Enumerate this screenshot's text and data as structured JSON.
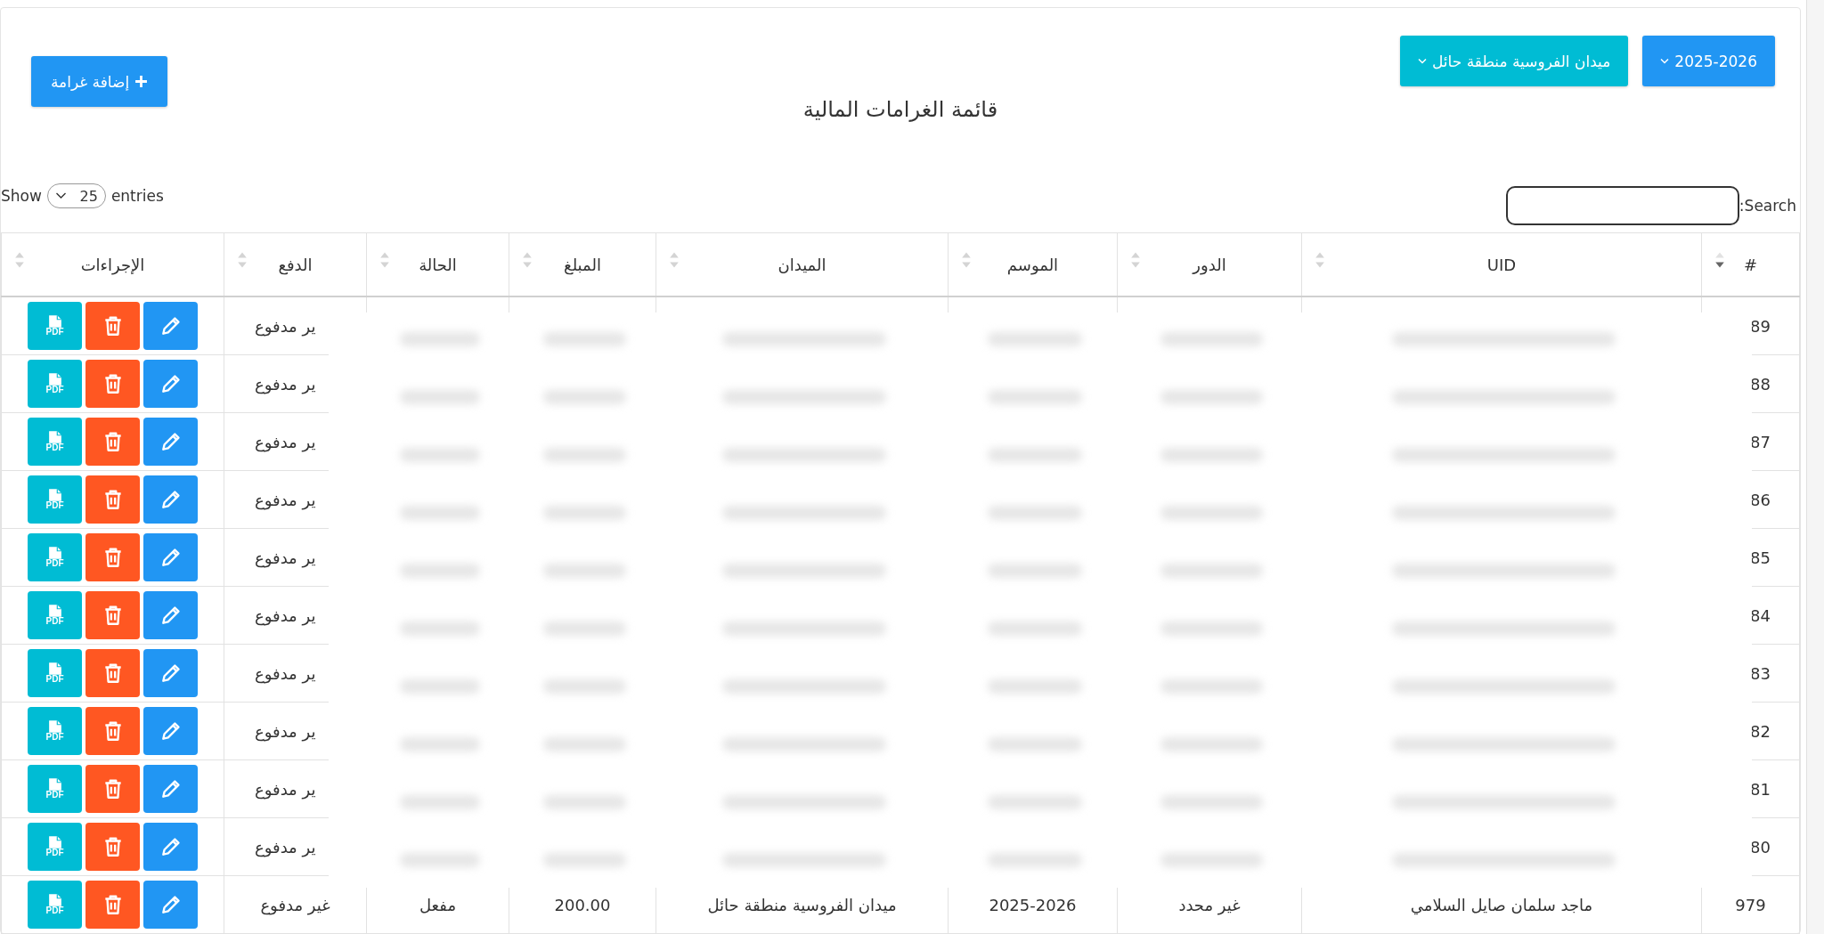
{
  "toolbar": {
    "season_button": "2025-2026",
    "arena_button": "ميدان الفروسية منطقة حائل",
    "add_button": "إضافة غرامة"
  },
  "title": "قائمة الغرامات المالية",
  "length": {
    "show": "Show",
    "value": "25",
    "entries": "entries"
  },
  "search": {
    "label": ":Search"
  },
  "table": {
    "columns": [
      {
        "label": "#",
        "sorted": true
      },
      {
        "label": "UID",
        "sorted": false
      },
      {
        "label": "الدور",
        "sorted": false
      },
      {
        "label": "الموسم",
        "sorted": false
      },
      {
        "label": "الميدان",
        "sorted": false
      },
      {
        "label": "المبلغ",
        "sorted": false
      },
      {
        "label": "الحالة",
        "sorted": false
      },
      {
        "label": "الدفع",
        "sorted": false
      },
      {
        "label": "الإجراءات",
        "sorted": false
      }
    ],
    "rows": [
      {
        "kind": "redacted",
        "number": "89",
        "payment": "ير مدفوع",
        "pdf_label": "PDF"
      },
      {
        "kind": "redacted",
        "number": "88",
        "payment": "ير مدفوع",
        "pdf_label": "PDF"
      },
      {
        "kind": "redacted",
        "number": "87",
        "payment": "ير مدفوع",
        "pdf_label": "PDF"
      },
      {
        "kind": "redacted",
        "number": "86",
        "payment": "ير مدفوع",
        "pdf_label": "PDF"
      },
      {
        "kind": "redacted",
        "number": "85",
        "payment": "ير مدفوع",
        "pdf_label": "PDF"
      },
      {
        "kind": "redacted",
        "number": "84",
        "payment": "ير مدفوع",
        "pdf_label": "PDF"
      },
      {
        "kind": "redacted",
        "number": "83",
        "payment": "ير مدفوع",
        "pdf_label": "PDF"
      },
      {
        "kind": "redacted",
        "number": "82",
        "payment": "ير مدفوع",
        "pdf_label": "PDF"
      },
      {
        "kind": "redacted",
        "number": "81",
        "payment": "ير مدفوع",
        "pdf_label": "PDF"
      },
      {
        "kind": "redacted",
        "number": "80",
        "payment": "ير مدفوع",
        "pdf_label": "PDF"
      },
      {
        "kind": "full",
        "pdf_label": "PDF",
        "number": "979",
        "uid": "ماجد سلمان صايل السلامي",
        "role": "غير محدد",
        "season": "2025-2026",
        "arena": "ميدان الفروسية منطقة حائل",
        "amount": "200.00",
        "status": "مفعل",
        "payment": "غير مدفوع"
      }
    ]
  }
}
